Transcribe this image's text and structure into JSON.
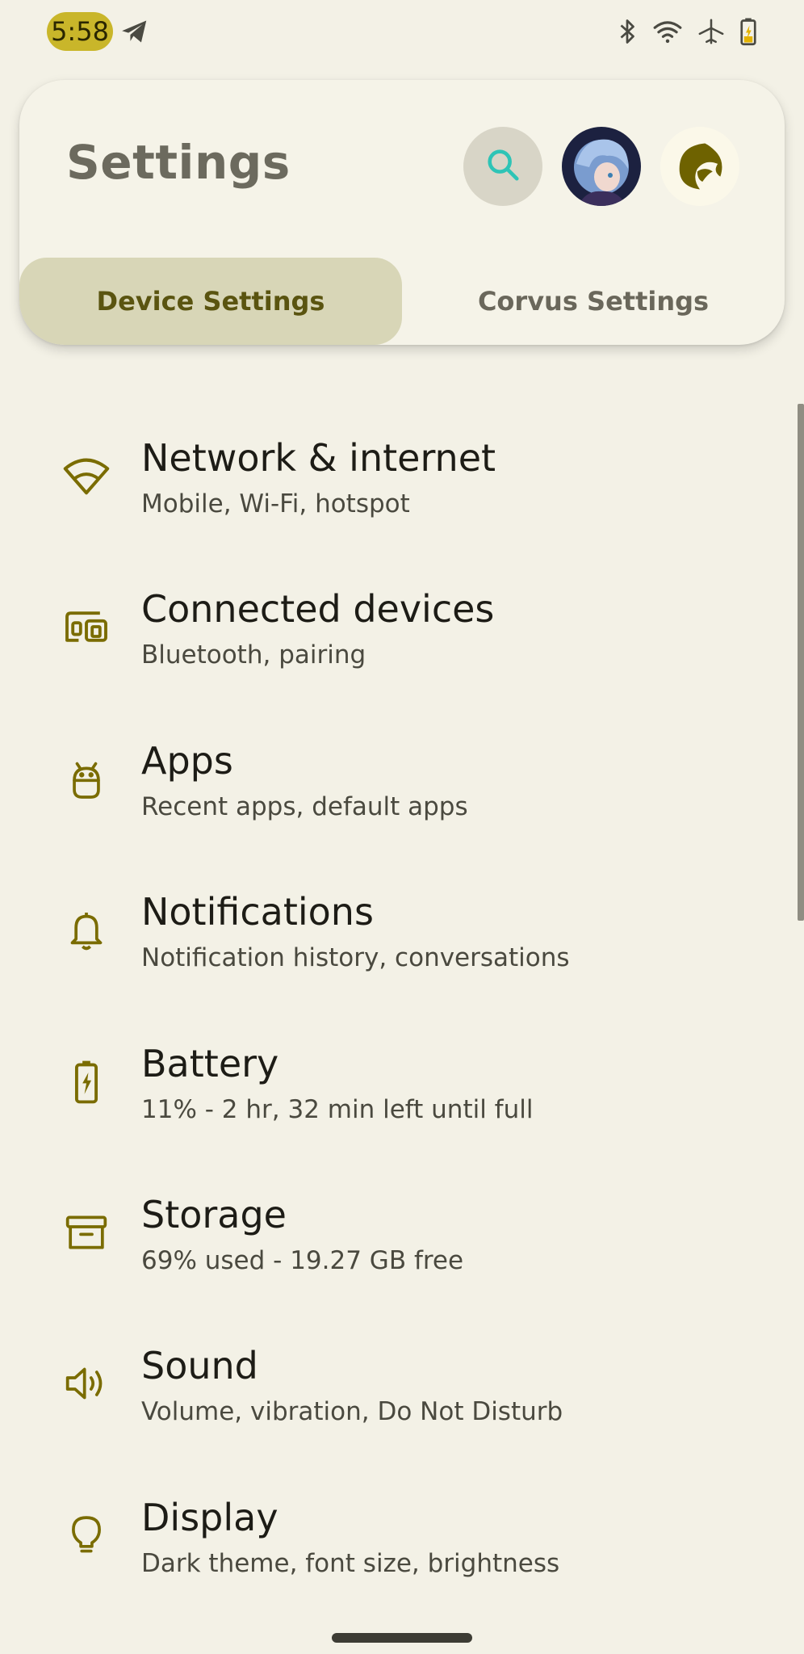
{
  "status_bar": {
    "time": "5:58",
    "icons": [
      "telegram-icon",
      "bluetooth-icon",
      "wifi-icon",
      "airplane-mode-icon",
      "battery-charging-icon"
    ]
  },
  "header": {
    "title": "Settings",
    "search_icon": "search-icon",
    "avatar": "user-avatar",
    "logo": "corvus-logo",
    "tabs": [
      {
        "label": "Device Settings",
        "selected": true
      },
      {
        "label": "Corvus Settings",
        "selected": false
      }
    ]
  },
  "colors": {
    "background": "#f3f1e6",
    "accent": "#7a6c00",
    "selected_tab": "#d8d6b7",
    "search_icon": "#2ec4b6",
    "clock_pill": "#c9b62a"
  },
  "settings": [
    {
      "icon": "wifi-icon",
      "title": "Network & internet",
      "subtitle": "Mobile, Wi-Fi, hotspot"
    },
    {
      "icon": "devices-icon",
      "title": "Connected devices",
      "subtitle": "Bluetooth, pairing"
    },
    {
      "icon": "android-icon",
      "title": "Apps",
      "subtitle": "Recent apps, default apps"
    },
    {
      "icon": "bell-icon",
      "title": "Notifications",
      "subtitle": "Notification history, conversations"
    },
    {
      "icon": "battery-icon",
      "title": "Battery",
      "subtitle": "11% - 2 hr, 32 min left until full"
    },
    {
      "icon": "storage-icon",
      "title": "Storage",
      "subtitle": "69% used - 19.27 GB free"
    },
    {
      "icon": "volume-icon",
      "title": "Sound",
      "subtitle": "Volume, vibration, Do Not Disturb"
    },
    {
      "icon": "lightbulb-icon",
      "title": "Display",
      "subtitle": "Dark theme, font size, brightness"
    }
  ]
}
